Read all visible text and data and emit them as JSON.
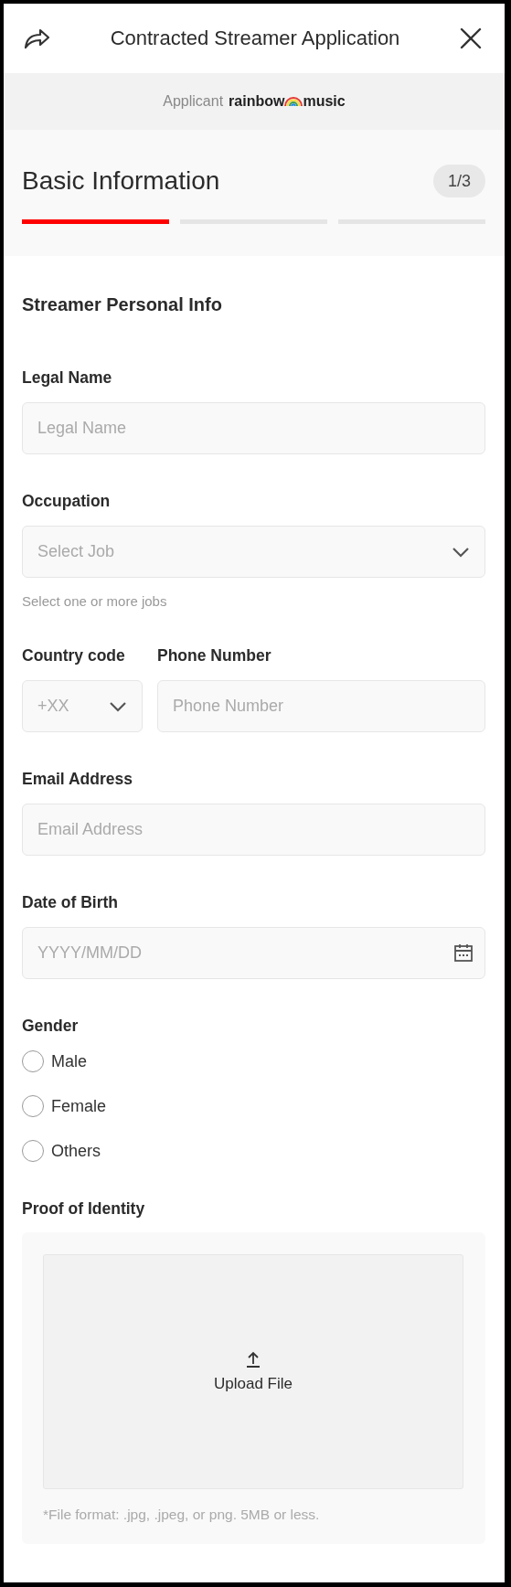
{
  "header": {
    "title": "Contracted Streamer Application"
  },
  "applicant": {
    "label": "Applicant",
    "name_before": "rainbow",
    "name_after": "music"
  },
  "progress": {
    "title": "Basic Information",
    "counter": "1/3",
    "steps": [
      {
        "selected": true
      },
      {
        "selected": false
      },
      {
        "selected": false
      }
    ]
  },
  "section_title": "Streamer Personal Info",
  "fields": [
    {
      "kind": "text",
      "label": "Legal Name",
      "placeholder": "Legal Name"
    },
    {
      "kind": "select",
      "label": "Occupation",
      "placeholder": "Select Job",
      "hint": "Select one or more jobs"
    },
    {
      "kind": "pair",
      "items": [
        {
          "kind": "select",
          "label": "Country code",
          "placeholder": "+XX"
        },
        {
          "kind": "text",
          "label": "Phone Number",
          "placeholder": "Phone Number"
        }
      ]
    },
    {
      "kind": "text",
      "label": "Email Address",
      "placeholder": "Email Address"
    },
    {
      "kind": "date",
      "label": "Date of Birth",
      "placeholder": "YYYY/MM/DD"
    },
    {
      "kind": "radio",
      "label": "Gender",
      "options": [
        {
          "label": "Male",
          "selected": false
        },
        {
          "label": "Female",
          "selected": false
        },
        {
          "label": "Others",
          "selected": false
        }
      ]
    },
    {
      "kind": "upload",
      "label": "Proof of Identity",
      "button": "Upload File",
      "hint": "*File format: .jpg, .jpeg, or png. 5MB or less."
    }
  ]
}
